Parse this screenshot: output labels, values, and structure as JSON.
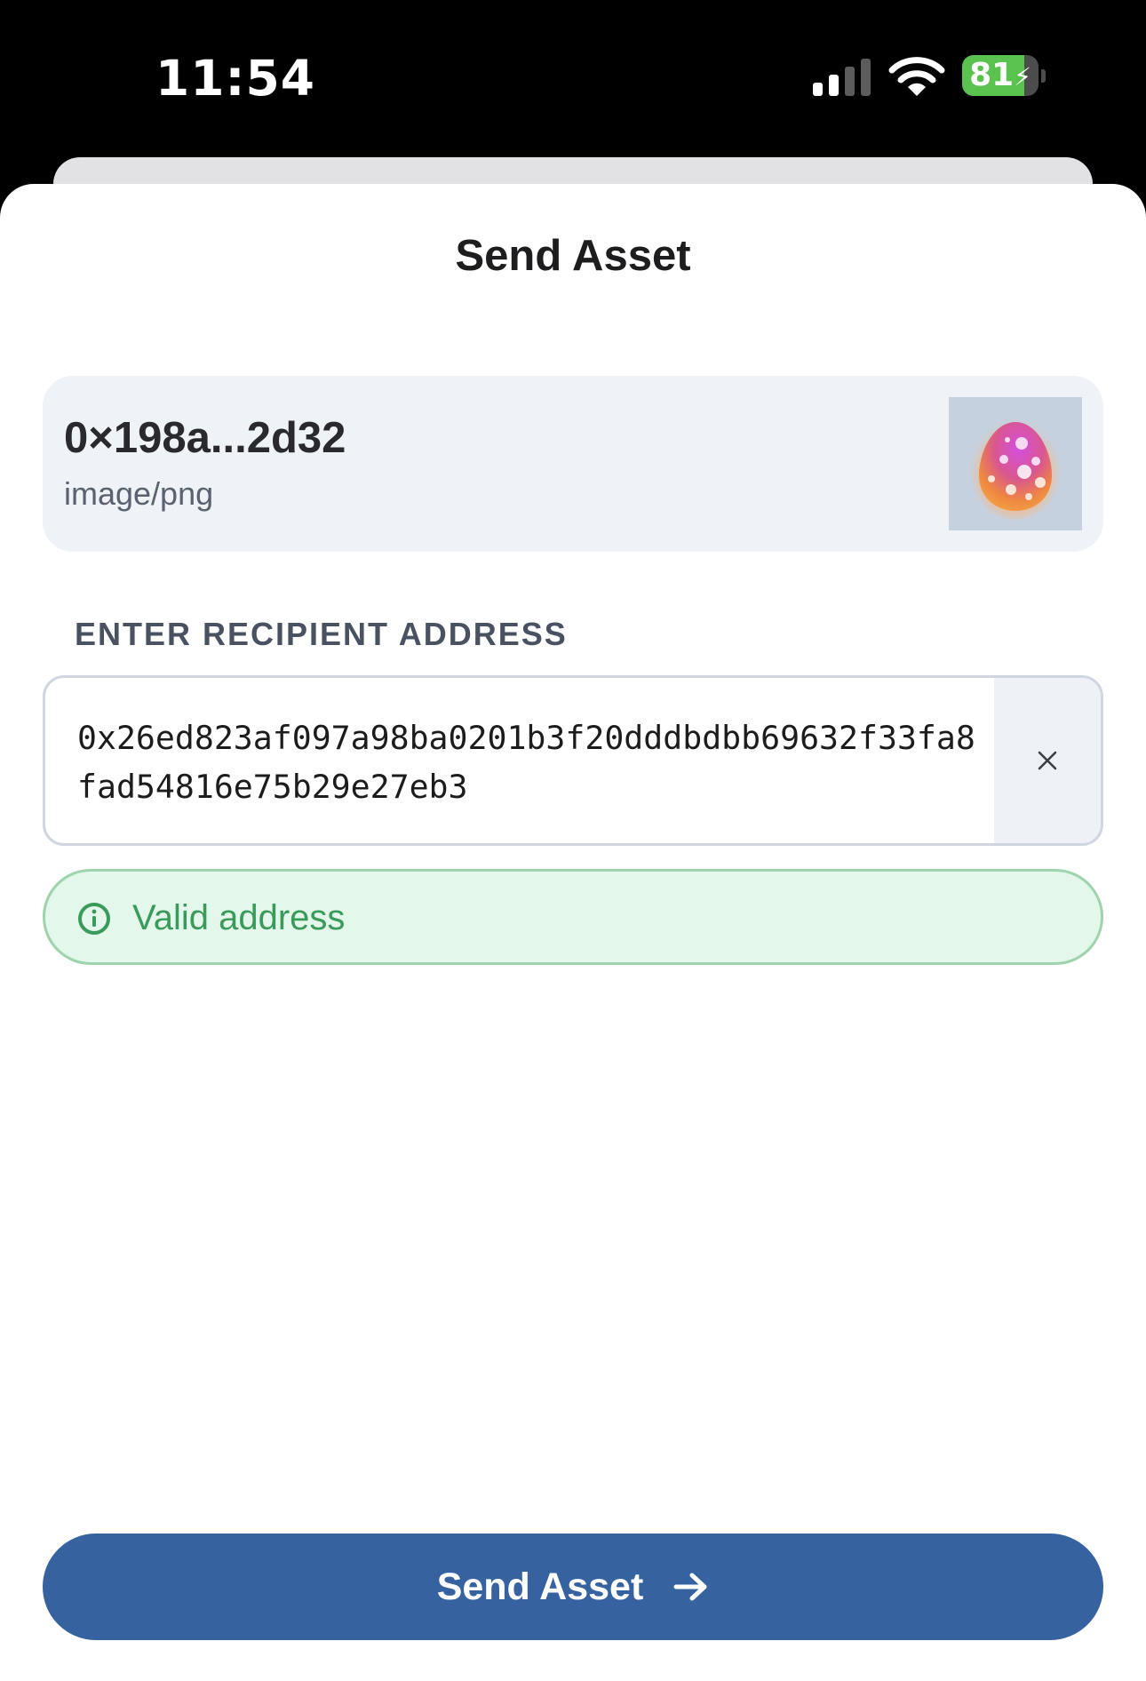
{
  "status_bar": {
    "time": "11:54",
    "battery_percent": "81",
    "battery_level": 0.81,
    "signal_bars_active": 2,
    "signal_bars_total": 4,
    "icons": [
      "signal-icon",
      "wifi-icon",
      "battery-icon",
      "charging-bolt-icon"
    ]
  },
  "sheet": {
    "title": "Send Asset"
  },
  "asset": {
    "id": "0×198a...2d32",
    "type": "image/png",
    "thumbnail_icon": "spotted-egg-image"
  },
  "recipient": {
    "label": "ENTER RECIPIENT ADDRESS",
    "address": "0x26ed823af097a98ba0201b3f20dddbdbb69632f33fa8fad54816e75b29e27eb3",
    "clear_icon": "close-icon"
  },
  "validation": {
    "message": "Valid address",
    "icon": "info-icon",
    "color": "#3a9a5b"
  },
  "actions": {
    "send_label": "Send Asset",
    "send_icon": "arrow-right-icon",
    "button_color": "#3662a0"
  }
}
